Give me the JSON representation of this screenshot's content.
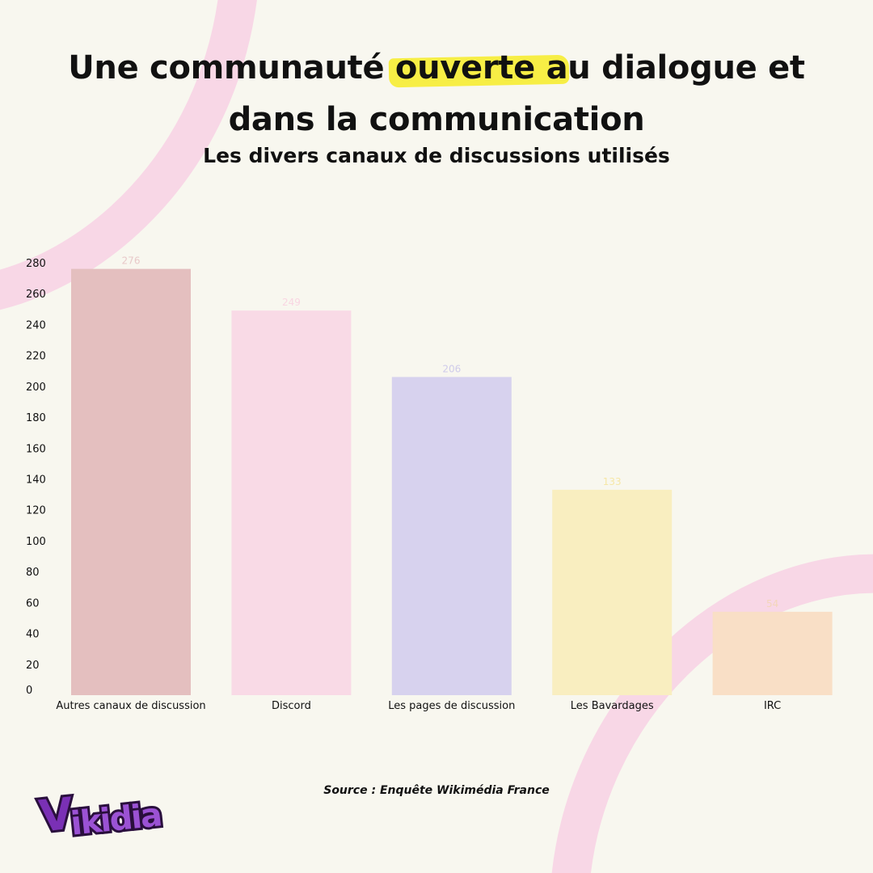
{
  "page": {
    "title_before": "Une communauté ",
    "title_highlight": "ouverte a",
    "title_after": "u dialogue et",
    "title_line2": "dans la communication",
    "subtitle": "Les divers canaux de discussions utilisés",
    "source": "Source : Enquête Wikimédia France",
    "logo_text": "Vikidia"
  },
  "colors": {
    "background": "#f8f7ef",
    "arc": "#f8d7e6",
    "highlight": "#f7ee45",
    "logo_purple": "#8a3fc0"
  },
  "chart_data": {
    "type": "bar",
    "title": "Les divers canaux de discussions utilisés",
    "categories": [
      "Autres canaux de discussion",
      "Discord",
      "Les pages de discussion",
      "Les Bavardages",
      "IRC"
    ],
    "values": [
      276,
      249,
      206,
      133,
      54
    ],
    "value_labels": [
      "276",
      "249",
      "206",
      "133",
      "54"
    ],
    "bar_colors": [
      "#e4bfbf",
      "#f9dae6",
      "#d7d2ee",
      "#f9eec0",
      "#f9dfc6"
    ],
    "label_colors": [
      "#e8c9c9",
      "#f9d6e2",
      "#cfcbea",
      "#f6e7a6",
      "#f3d6ba"
    ],
    "y_ticks": [
      0,
      20,
      40,
      60,
      80,
      100,
      120,
      140,
      160,
      180,
      200,
      220,
      240,
      260,
      280
    ],
    "ylim": [
      0,
      280
    ],
    "xlabel": "",
    "ylabel": "",
    "grid": false,
    "legend": "none"
  }
}
